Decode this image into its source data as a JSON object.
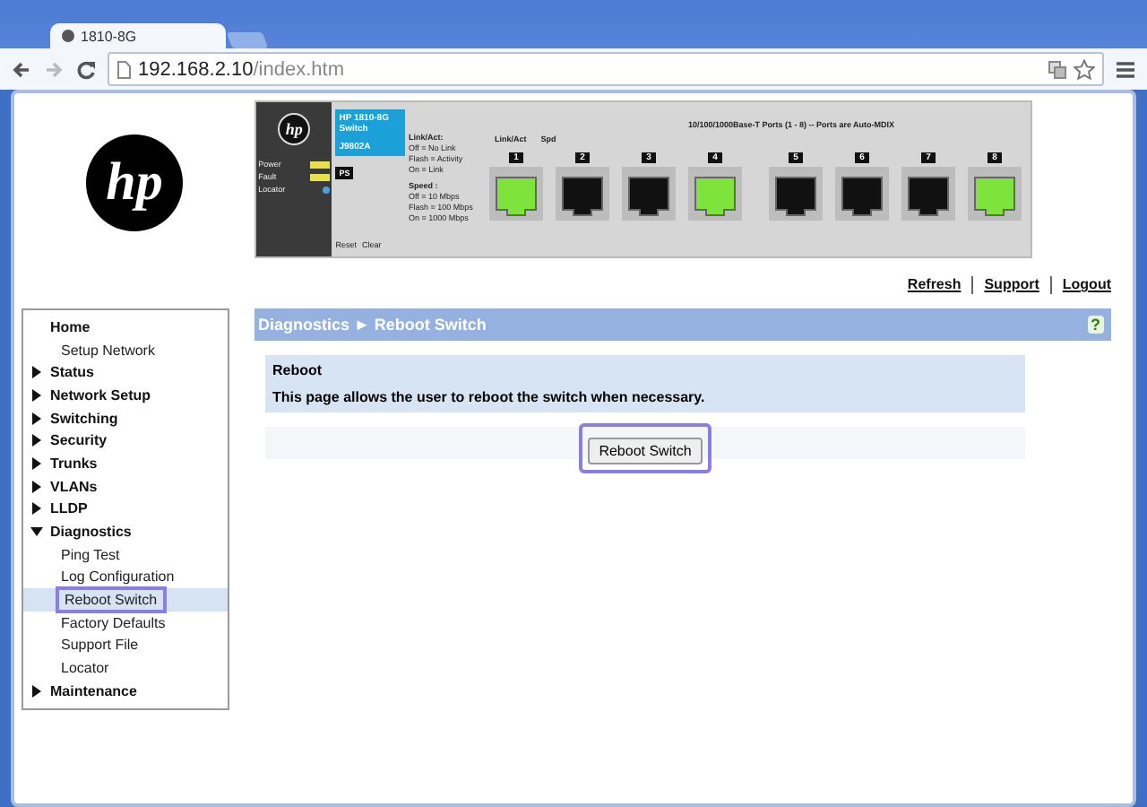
{
  "browser": {
    "tab_title": "1810-8G",
    "url_host": "192.168.2.10",
    "url_path": "/index.htm"
  },
  "logo": {
    "text": "hp"
  },
  "device": {
    "brand": "hp",
    "model": "HP 1810-8G Switch",
    "part_number": "J9802A",
    "ps_label": "PS",
    "leds": [
      {
        "label": "Power",
        "color": "#e8e04a"
      },
      {
        "label": "Fault",
        "color": "#e8e04a"
      },
      {
        "label": "Locator",
        "color": "#4aa0e0"
      }
    ],
    "buttons": [
      "Reset",
      "Clear"
    ],
    "legend_title": "Link/Act:",
    "legend": [
      "Off = No Link",
      "Flash = Activity",
      "On = Link"
    ],
    "speed_title": "Speed :",
    "speed_legend": [
      "Off = 10 Mbps",
      "Flash = 100 Mbps",
      "On = 1000 Mbps"
    ],
    "mode_labels": [
      "Link/Act",
      "Spd"
    ],
    "ports_title": "10/100/1000Base-T Ports (1 - 8) -- Ports are Auto-MDIX",
    "ports": [
      {
        "number": "1",
        "on": true
      },
      {
        "number": "2",
        "on": false
      },
      {
        "number": "3",
        "on": false
      },
      {
        "number": "4",
        "on": true
      },
      {
        "number": "5",
        "on": false
      },
      {
        "number": "6",
        "on": false
      },
      {
        "number": "7",
        "on": false
      },
      {
        "number": "8",
        "on": true
      }
    ]
  },
  "top_links": [
    "Refresh",
    "Support",
    "Logout"
  ],
  "sidebar": {
    "items": [
      {
        "label": "Home",
        "kind": "link",
        "children": [
          {
            "label": "Setup Network",
            "selected": false
          }
        ]
      },
      {
        "label": "Status",
        "kind": "folder",
        "expanded": false
      },
      {
        "label": "Network Setup",
        "kind": "folder",
        "expanded": false
      },
      {
        "label": "Switching",
        "kind": "folder",
        "expanded": false
      },
      {
        "label": "Security",
        "kind": "folder",
        "expanded": false
      },
      {
        "label": "Trunks",
        "kind": "folder",
        "expanded": false
      },
      {
        "label": "VLANs",
        "kind": "folder",
        "expanded": false
      },
      {
        "label": "LLDP",
        "kind": "folder",
        "expanded": false
      },
      {
        "label": "Diagnostics",
        "kind": "folder",
        "expanded": true,
        "children": [
          {
            "label": "Ping Test",
            "selected": false
          },
          {
            "label": "Log Configuration",
            "selected": false
          },
          {
            "label": "Reboot Switch",
            "selected": true,
            "highlighted": true
          },
          {
            "label": "Factory Defaults",
            "selected": false
          },
          {
            "label": "Support File",
            "selected": false
          },
          {
            "label": "Locator",
            "selected": false
          }
        ]
      },
      {
        "label": "Maintenance",
        "kind": "folder",
        "expanded": false
      }
    ]
  },
  "breadcrumb": [
    "Diagnostics",
    "►",
    "Reboot Switch"
  ],
  "help": "?",
  "panel": {
    "title": "Reboot",
    "text": "This page allows the user to reboot the switch when necessary."
  },
  "action": {
    "label": "Reboot Switch",
    "highlighted": true
  }
}
